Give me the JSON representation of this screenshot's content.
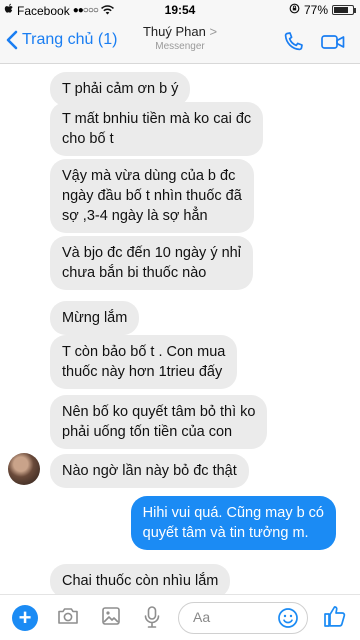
{
  "status_bar": {
    "carrier": "Facebook",
    "time": "19:54",
    "battery_percent": "77%",
    "battery_level": 0.77
  },
  "nav": {
    "back_label": "Trang chủ (1)",
    "contact_name": "Thuý Phan",
    "contact_chevron": ">",
    "app_label": "Messenger",
    "icons": [
      "phone-icon",
      "video-camera-icon"
    ]
  },
  "messages": [
    {
      "direction": "in",
      "text": "T phải cảm ơn b ý"
    },
    {
      "direction": "in",
      "text": "T mất bnhiu tiền mà ko cai đc\ncho bố t"
    },
    {
      "direction": "in",
      "text": "Vậy mà vừa dùng của b đc\nngày đầu bố t nhìn thuốc đã\nsợ ,3-4 ngày là sợ hẳn"
    },
    {
      "direction": "in",
      "text": "Và bjo đc đến 10 ngày ý nhỉ\nchưa bắn bi thuốc nào"
    },
    {
      "direction": "in",
      "text": "Mừng lắm"
    },
    {
      "direction": "in",
      "text": "T còn bảo bố t . Con mua\nthuốc này hơn 1trieu đấy"
    },
    {
      "direction": "in",
      "text": "Nên bố ko quyết tâm bỏ thì ko\nphải uống tốn tiền của con"
    },
    {
      "direction": "in",
      "text": "Nào ngờ lần này bỏ đc thật"
    },
    {
      "direction": "out",
      "text": "Hihi vui quá. Cũng may b có\nquyết tâm và tin tưởng m."
    },
    {
      "direction": "in",
      "text": "Chai thuốc còn nhìu lắm"
    }
  ],
  "composer": {
    "placeholder": "Aa",
    "icons": [
      "plus-icon",
      "camera-icon",
      "image-icon",
      "microphone-icon",
      "emoji-icon",
      "like-icon"
    ],
    "accent": "#1b8bf4"
  }
}
